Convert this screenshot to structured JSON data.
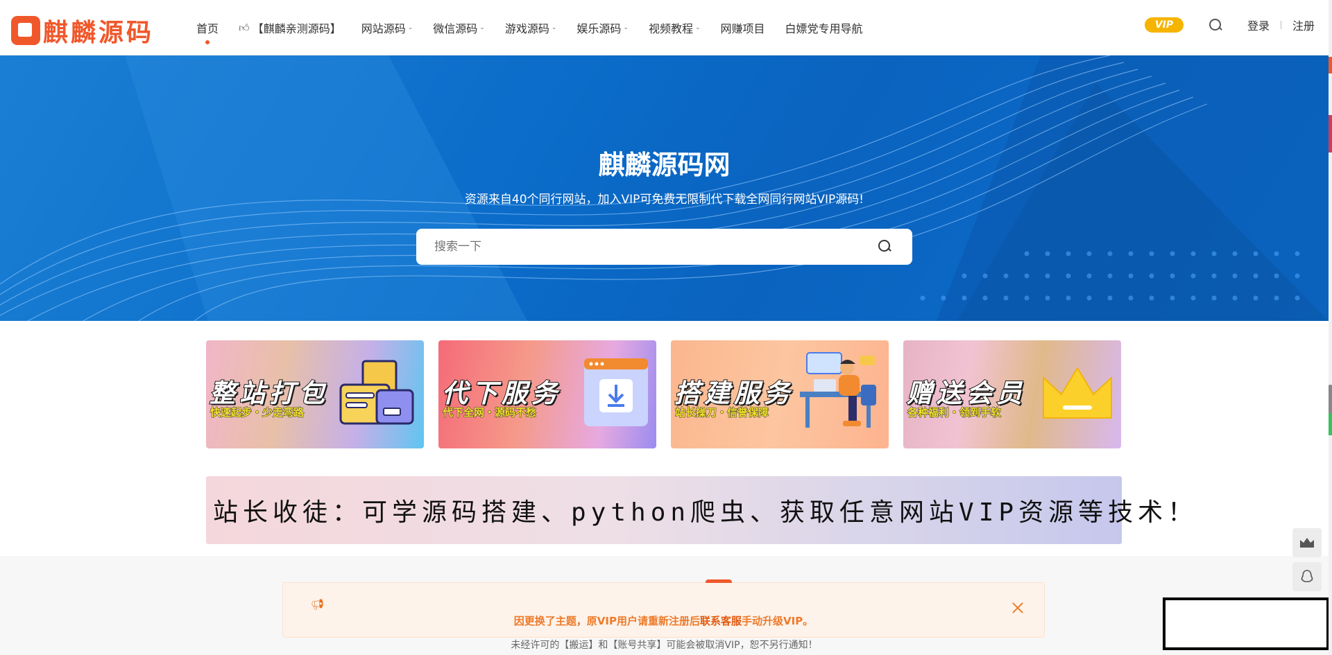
{
  "header": {
    "logo_text": "麒麟源码",
    "nav": [
      {
        "label": "首页",
        "dropdown": false,
        "active": true
      },
      {
        "label": "【麒麟亲测源码】",
        "dropdown": false,
        "icon": "thumbs-up-icon"
      },
      {
        "label": "网站源码",
        "dropdown": true
      },
      {
        "label": "微信源码",
        "dropdown": true
      },
      {
        "label": "游戏源码",
        "dropdown": true
      },
      {
        "label": "娱乐源码",
        "dropdown": true
      },
      {
        "label": "视频教程",
        "dropdown": true
      },
      {
        "label": "网赚项目",
        "dropdown": false
      },
      {
        "label": "白嫖党专用导航",
        "dropdown": false
      }
    ],
    "vip_label": "VIP",
    "login_label": "登录",
    "register_label": "注册"
  },
  "hero": {
    "title": "麒麟源码网",
    "subtitle": "资源来自40个同行网站，加入VIP可免费无限制代下载全网同行网站VIP源码!",
    "search_placeholder": "搜索一下"
  },
  "cards": [
    {
      "title": "整站打包",
      "subtitle": "快速起步・少走弯路"
    },
    {
      "title": "代下服务",
      "subtitle": "代下全网・源码不愁"
    },
    {
      "title": "搭建服务",
      "subtitle": "站长操刀・信誉保障"
    },
    {
      "title": "赠送会员",
      "subtitle": "各种福利・领到手软"
    }
  ],
  "banner": {
    "text": "站长收徒：可学源码搭建、python爬虫、获取任意网站VIP资源等技术！"
  },
  "notice": {
    "text_prefix": "因更换了主题，原VIP用户请重新注册后",
    "text_strong": "联系客服",
    "text_suffix": "手动升级VIP。"
  },
  "footer_note": "未经许可的【搬运】和【账号共享】可能会被取消VIP，恕不另行通知！",
  "colors": {
    "brand": "#f0582b",
    "hero_blue": "#0b6cc9",
    "vip_gold": "#f5b400",
    "notice_text": "#ee7a2a"
  }
}
